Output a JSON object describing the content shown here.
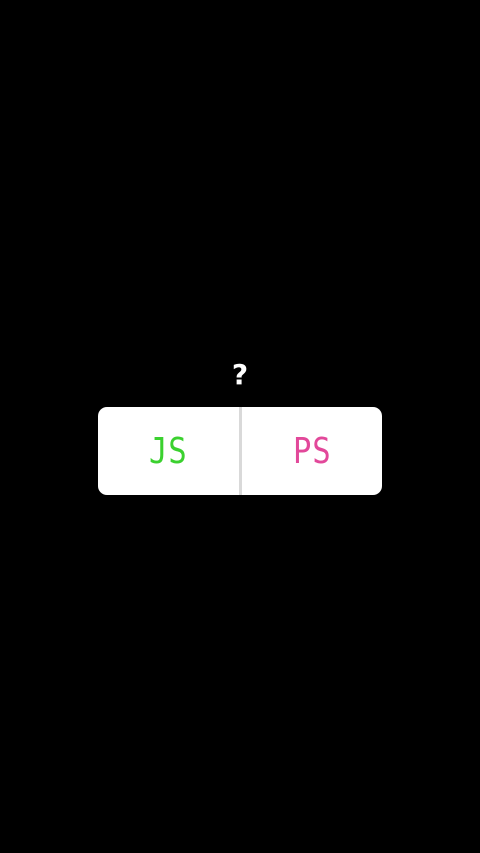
{
  "poll": {
    "question": "?",
    "options": [
      {
        "label": "JS",
        "color": "#3bd12f"
      },
      {
        "label": "PS",
        "color": "#e2489a"
      }
    ]
  },
  "colors": {
    "background": "#000000",
    "card": "#ffffff",
    "divider": "#d9d9d9",
    "question": "#ffffff"
  }
}
